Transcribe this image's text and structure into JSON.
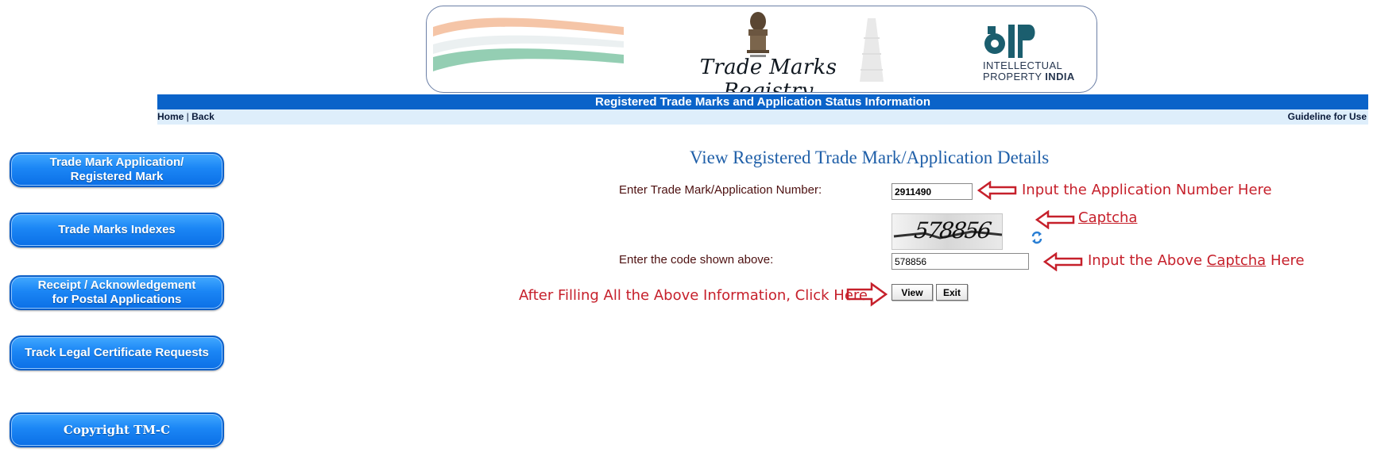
{
  "header": {
    "registry_title": "Trade Marks Registry",
    "ip_line1": "INTELLECTUAL",
    "ip_line2_prefix": "PROPERTY ",
    "ip_line2_bold": "INDIA",
    "banner_title": "Registered Trade Marks and Application Status Information",
    "nav": {
      "home": "Home",
      "separator": " | ",
      "back": "Back",
      "guideline": "Guideline for Use"
    }
  },
  "sidebar": {
    "items": [
      {
        "line1": "Trade Mark Application/",
        "line2": "Registered Mark"
      },
      {
        "line1": "Trade Marks Indexes",
        "line2": ""
      },
      {
        "line1": "Receipt / Acknowledgement",
        "line2": "for Postal Applications"
      },
      {
        "line1": "Track Legal Certificate Requests",
        "line2": ""
      },
      {
        "line1": "Copyright TM-C",
        "line2": ""
      }
    ]
  },
  "form": {
    "title": "View Registered Trade Mark/Application Details",
    "app_number_label": "Enter Trade Mark/Application Number:",
    "app_number_value": "2911490",
    "captcha_text": "578856",
    "code_label": "Enter the code shown above:",
    "code_value": "578856",
    "view_button": "View",
    "exit_button": "Exit"
  },
  "annotations": {
    "app_number": "Input the Application Number Here",
    "captcha": "Captcha",
    "code_prefix": "Input the Above ",
    "code_link": "Captcha",
    "code_suffix": " Here",
    "click": "After Filling All the Above Information, Click Here"
  },
  "colors": {
    "title_bar": "#0a63c9",
    "sub_bar": "#deeefb",
    "sidebar_button": "#1b86f5",
    "page_title": "#1f5fa8",
    "label_text": "#4d1010",
    "annotation": "#c6202b"
  }
}
